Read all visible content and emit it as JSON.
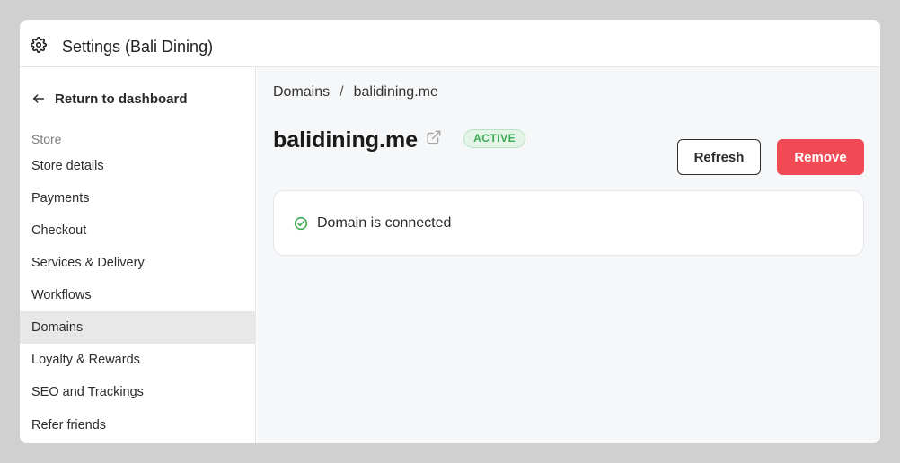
{
  "window": {
    "title": "Settings (Bali Dining)",
    "icon": "gear-icon"
  },
  "sidebar": {
    "back_label": "Return to dashboard",
    "section_label": "Store",
    "items": [
      {
        "label": "Store details",
        "active": false
      },
      {
        "label": "Payments",
        "active": false
      },
      {
        "label": "Checkout",
        "active": false
      },
      {
        "label": "Services & Delivery",
        "active": false
      },
      {
        "label": "Workflows",
        "active": false
      },
      {
        "label": "Domains",
        "active": true
      },
      {
        "label": "Loyalty & Rewards",
        "active": false
      },
      {
        "label": "SEO and Trackings",
        "active": false
      },
      {
        "label": "Refer friends",
        "active": false
      }
    ]
  },
  "main": {
    "breadcrumb": {
      "parent": "Domains",
      "separator": "/",
      "current": "balidining.me"
    },
    "domain_name": "balidining.me",
    "status_badge": "ACTIVE",
    "refresh_label": "Refresh",
    "remove_label": "Remove",
    "status_message": "Domain is connected"
  },
  "colors": {
    "accent_remove": "#f04b55",
    "badge_green": "#3daa57",
    "active_nav_bg": "#e8e8e8"
  }
}
